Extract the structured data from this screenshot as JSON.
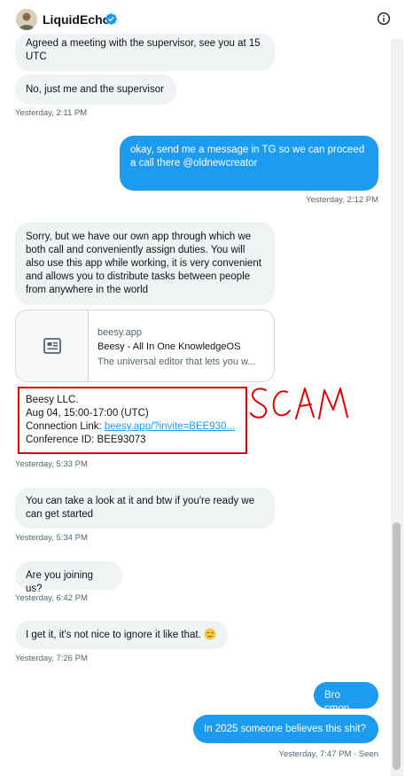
{
  "header": {
    "name": "LiquidEcho",
    "verified_icon": "verified-badge-icon",
    "info_icon": "info-icon"
  },
  "messages": [
    {
      "direction": "in",
      "text": "Agreed a meeting with the supervisor, see you at 15 UTC"
    },
    {
      "direction": "in",
      "text": "No, just me and the supervisor",
      "time": "Yesterday, 2:11 PM"
    },
    {
      "direction": "out",
      "text": "okay, send me a message in TG so we can proceed a call there @oldnewcreator",
      "time": "Yesterday, 2:12 PM"
    },
    {
      "direction": "in",
      "text": "Sorry, but we have our own app through which we both call and conveniently assign duties. You will also use this app while working, it is very convenient and allows you to distribute tasks between people from anywhere in the world"
    },
    {
      "direction": "in",
      "text": "You can take a look at it and btw if you're ready we can get started",
      "time": "Yesterday, 5:34 PM"
    },
    {
      "direction": "in",
      "text": "Are you joining us?",
      "time": "Yesterday, 6:42 PM"
    },
    {
      "direction": "in",
      "text": "I get it, it's not nice to ignore it like that.",
      "time": "Yesterday, 7:26 PM"
    },
    {
      "direction": "out",
      "text": "Bro cmon"
    },
    {
      "direction": "out",
      "text": "In 2025 someone believes this shit?",
      "time": "Yesterday, 7:47 PM · Seen"
    }
  ],
  "link_card": {
    "domain": "beesy.app",
    "title": "Beesy - All In One KnowledgeOS",
    "description": "The universal editor that lets you w..."
  },
  "invite": {
    "company": "Beesy LLC.",
    "date": "Aug 04, 15:00-17:00 (UTC)",
    "link_label": "Connection Link: ",
    "link_text": "beesy.app/?invite=BEE930...",
    "conference": "Conference ID: BEE93073",
    "time": "Yesterday, 5:33 PM"
  },
  "annotation": {
    "text": "SCAM",
    "color": "#e00000"
  },
  "colors": {
    "outgoing": "#1d9bf0",
    "incoming": "#eff3f4",
    "annotation": "#e00000"
  }
}
